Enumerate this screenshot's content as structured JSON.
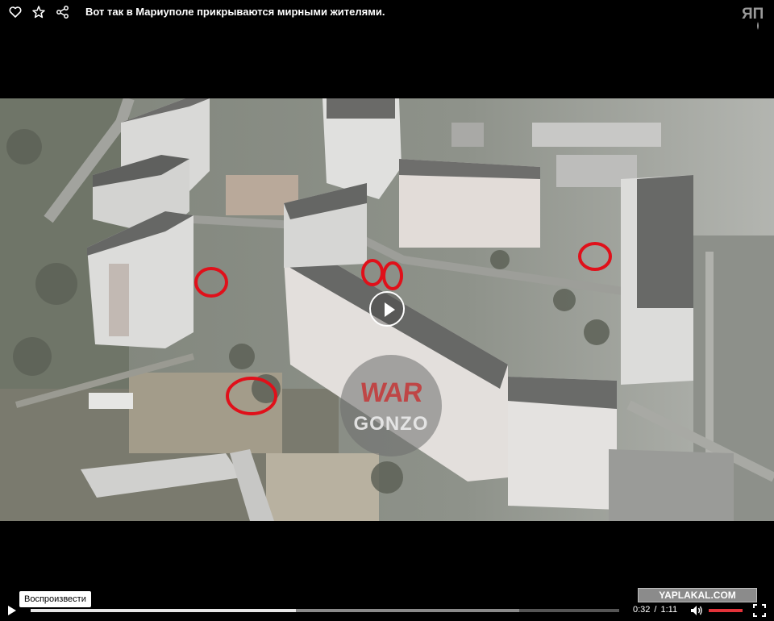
{
  "header": {
    "title": "Вот так в Мариуполе прикрываются мирными жителями.",
    "icons": [
      "heart-icon",
      "star-icon",
      "share-icon"
    ],
    "logo_text": "ЯП"
  },
  "video": {
    "watermark_top": "WAR",
    "watermark_bottom": "GONZO",
    "site_badge": "YAPLAKAL.COM",
    "tooltip": "Воспроизвести",
    "current_time": "0:32",
    "separator": "/",
    "duration": "1:11",
    "progress_fraction": 0.45,
    "volume_fraction": 1.0,
    "accent_color": "#e3333a",
    "highlight_color": "#e0101a"
  }
}
